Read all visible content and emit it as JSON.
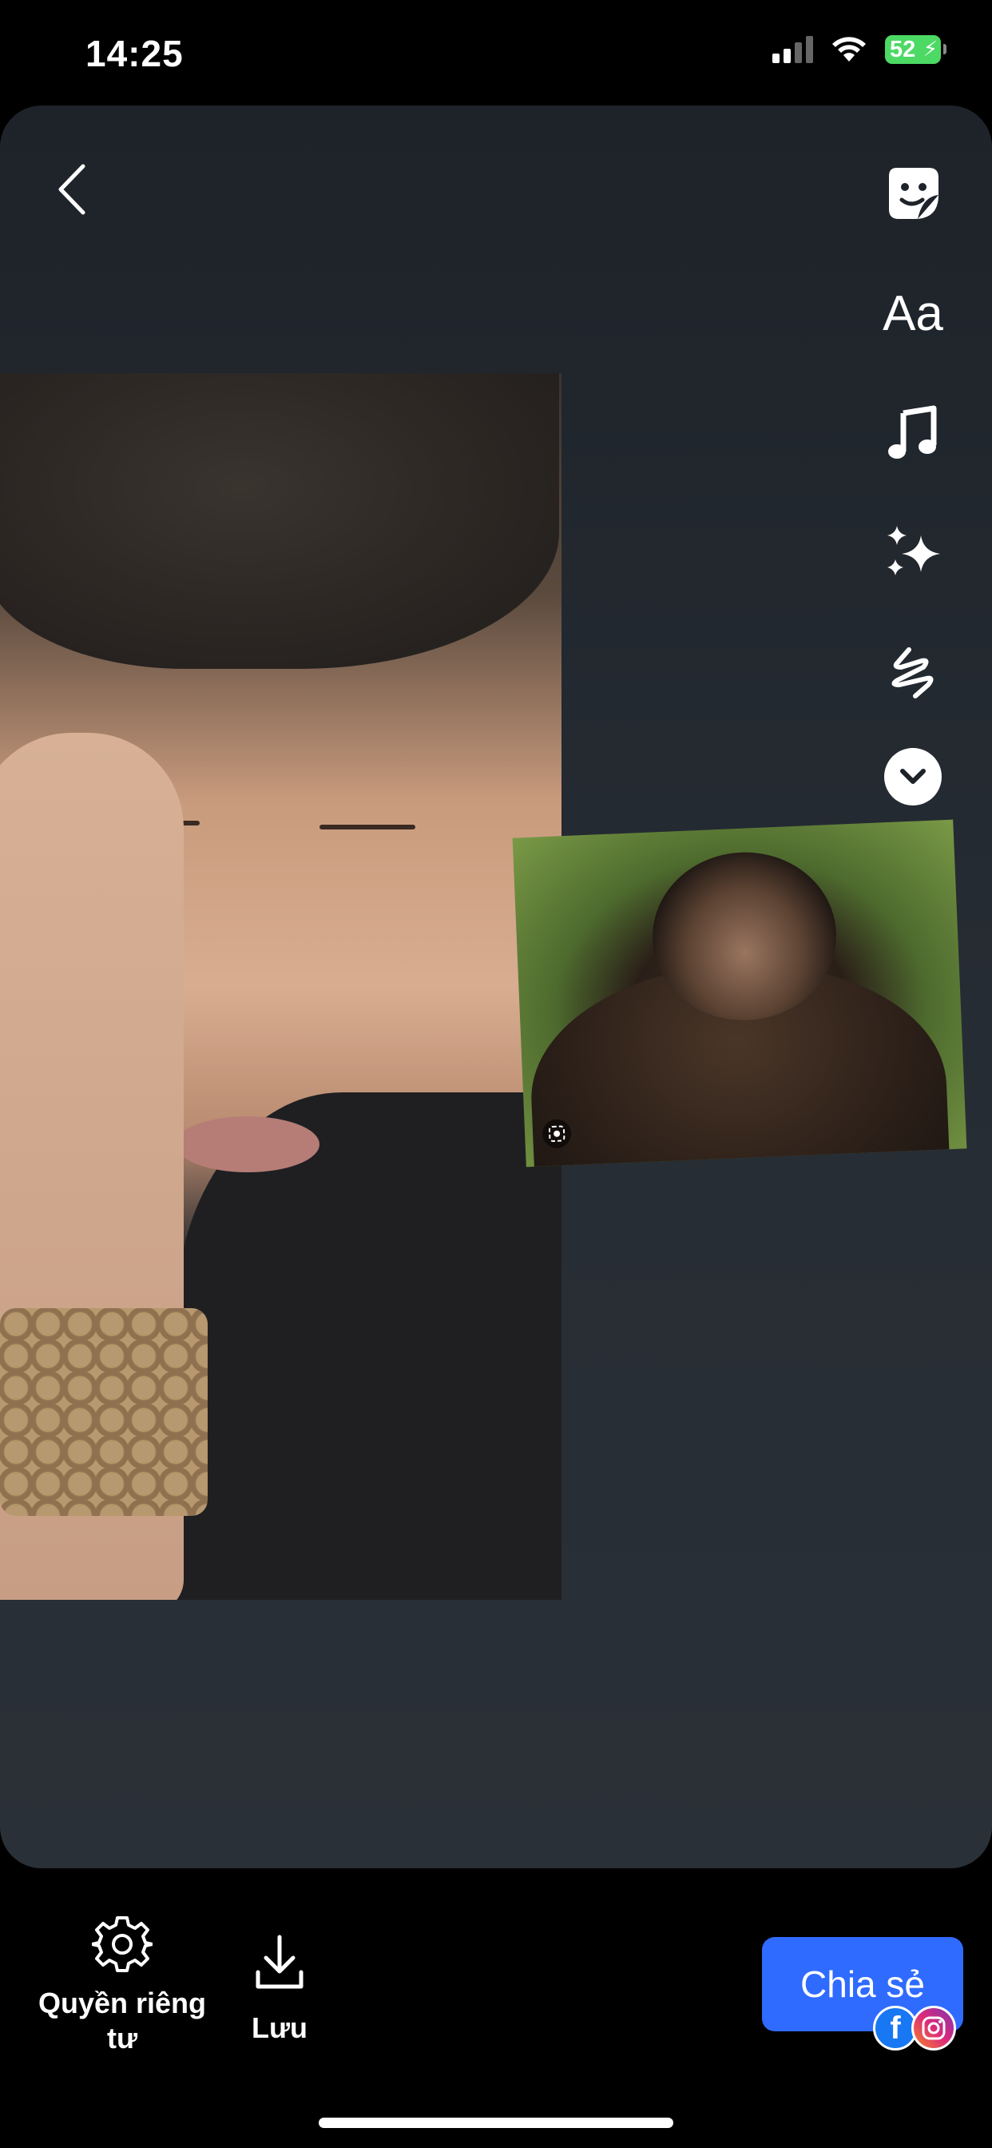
{
  "status_bar": {
    "time": "14:25",
    "battery": "52"
  },
  "toolbar": {
    "back_icon": "chevron-left-icon",
    "tools": [
      {
        "name": "sticker",
        "icon": "sticker-icon"
      },
      {
        "name": "text",
        "label": "Aa"
      },
      {
        "name": "music",
        "icon": "music-note-icon"
      },
      {
        "name": "effects",
        "icon": "sparkles-icon"
      },
      {
        "name": "draw",
        "icon": "scribble-icon"
      },
      {
        "name": "more",
        "icon": "chevron-down-icon"
      }
    ]
  },
  "bottom_bar": {
    "privacy_label": "Quyền riêng tư",
    "save_label": "Lưu",
    "share_label": "Chia sẻ"
  },
  "colors": {
    "share_button": "#2f6bff",
    "card_background": "#1d2329",
    "battery_green": "#4cd964"
  }
}
